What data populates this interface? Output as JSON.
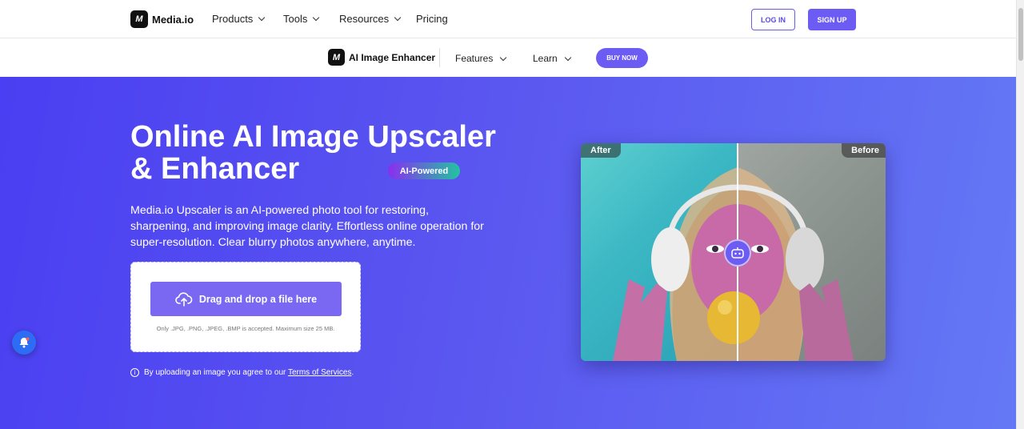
{
  "topnav": {
    "brand": "Media.io",
    "logo_text": "M",
    "items": [
      {
        "label": "Products"
      },
      {
        "label": "Tools"
      },
      {
        "label": "Resources"
      },
      {
        "label": "Pricing"
      }
    ],
    "login": "LOG IN",
    "signup": "SIGN UP"
  },
  "subnav": {
    "product": "AI Image Enhancer",
    "features": "Features",
    "learn": "Learn",
    "buy": "BUY NOW"
  },
  "hero": {
    "title_line1": "Online AI Image Upscaler",
    "title_line2": "& Enhancer",
    "badge": "AI-Powered",
    "description": "Media.io Upscaler is an AI-powered photo tool for restoring, sharpening, and improving image clarity. Effortless online operation for super-resolution. Clear blurry photos anywhere, anytime.",
    "upload_label": "Drag and drop a file here",
    "upload_note": "Only .JPG, .PNG, .JPEG, .BMP is accepted. Maximum size 25 MB.",
    "terms_prefix": "By uploading an image you agree to our ",
    "terms_link": "Terms of Services",
    "terms_suffix": "."
  },
  "compare": {
    "after_label": "After",
    "before_label": "Before"
  },
  "icons": {
    "logo": "mediaio-logo-icon",
    "chevron": "chevron-down-icon",
    "upload": "cloud-upload-icon",
    "info": "info-icon",
    "bell": "notification-bell-icon",
    "robot": "ai-robot-icon"
  },
  "colors": {
    "accent": "#6d5cf4",
    "hero_start": "#4a3ff2",
    "hero_end": "#6478f5"
  }
}
